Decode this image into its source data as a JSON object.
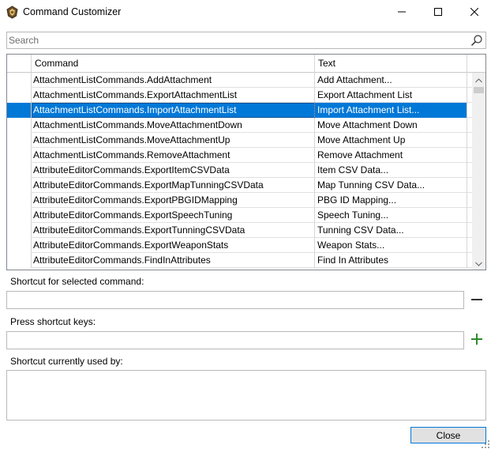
{
  "window": {
    "title": "Command Customizer",
    "icons": {
      "app": "app-badge-icon",
      "minimize": "minimize-icon",
      "maximize": "maximize-icon",
      "close": "close-icon"
    }
  },
  "search": {
    "placeholder": "Search",
    "value": "",
    "icon": "search-icon"
  },
  "grid": {
    "columns": {
      "command": "Command",
      "text": "Text"
    },
    "rows": [
      {
        "command": "AttachmentListCommands.AddAttachment",
        "text": "Add Attachment..."
      },
      {
        "command": "AttachmentListCommands.ExportAttachmentList",
        "text": "Export Attachment List"
      },
      {
        "command": "AttachmentListCommands.ImportAttachmentList",
        "text": "Import Attachment List..."
      },
      {
        "command": "AttachmentListCommands.MoveAttachmentDown",
        "text": "Move Attachment Down"
      },
      {
        "command": "AttachmentListCommands.MoveAttachmentUp",
        "text": "Move Attachment Up"
      },
      {
        "command": "AttachmentListCommands.RemoveAttachment",
        "text": "Remove Attachment"
      },
      {
        "command": "AttributeEditorCommands.ExportItemCSVData",
        "text": "Item CSV Data..."
      },
      {
        "command": "AttributeEditorCommands.ExportMapTunningCSVData",
        "text": "Map Tunning CSV Data..."
      },
      {
        "command": "AttributeEditorCommands.ExportPBGIDMapping",
        "text": "PBG ID Mapping..."
      },
      {
        "command": "AttributeEditorCommands.ExportSpeechTuning",
        "text": "Speech Tuning..."
      },
      {
        "command": "AttributeEditorCommands.ExportTunningCSVData",
        "text": "Tunning CSV Data..."
      },
      {
        "command": "AttributeEditorCommands.ExportWeaponStats",
        "text": "Weapon Stats..."
      },
      {
        "command": "AttributeEditorCommands.FindInAttributes",
        "text": "Find In Attributes"
      }
    ],
    "selected_index": 2
  },
  "shortcut_section": {
    "selected_label": "Shortcut for selected command:",
    "selected_value": "",
    "press_label": "Press shortcut keys:",
    "press_value": "",
    "used_by_label": "Shortcut currently used by:",
    "remove_icon": "minus-icon",
    "add_icon": "plus-icon"
  },
  "footer": {
    "close_label": "Close"
  },
  "colors": {
    "selection": "#0078d7",
    "add_icon": "#2e8b2e",
    "border": "#b9b9b9"
  }
}
